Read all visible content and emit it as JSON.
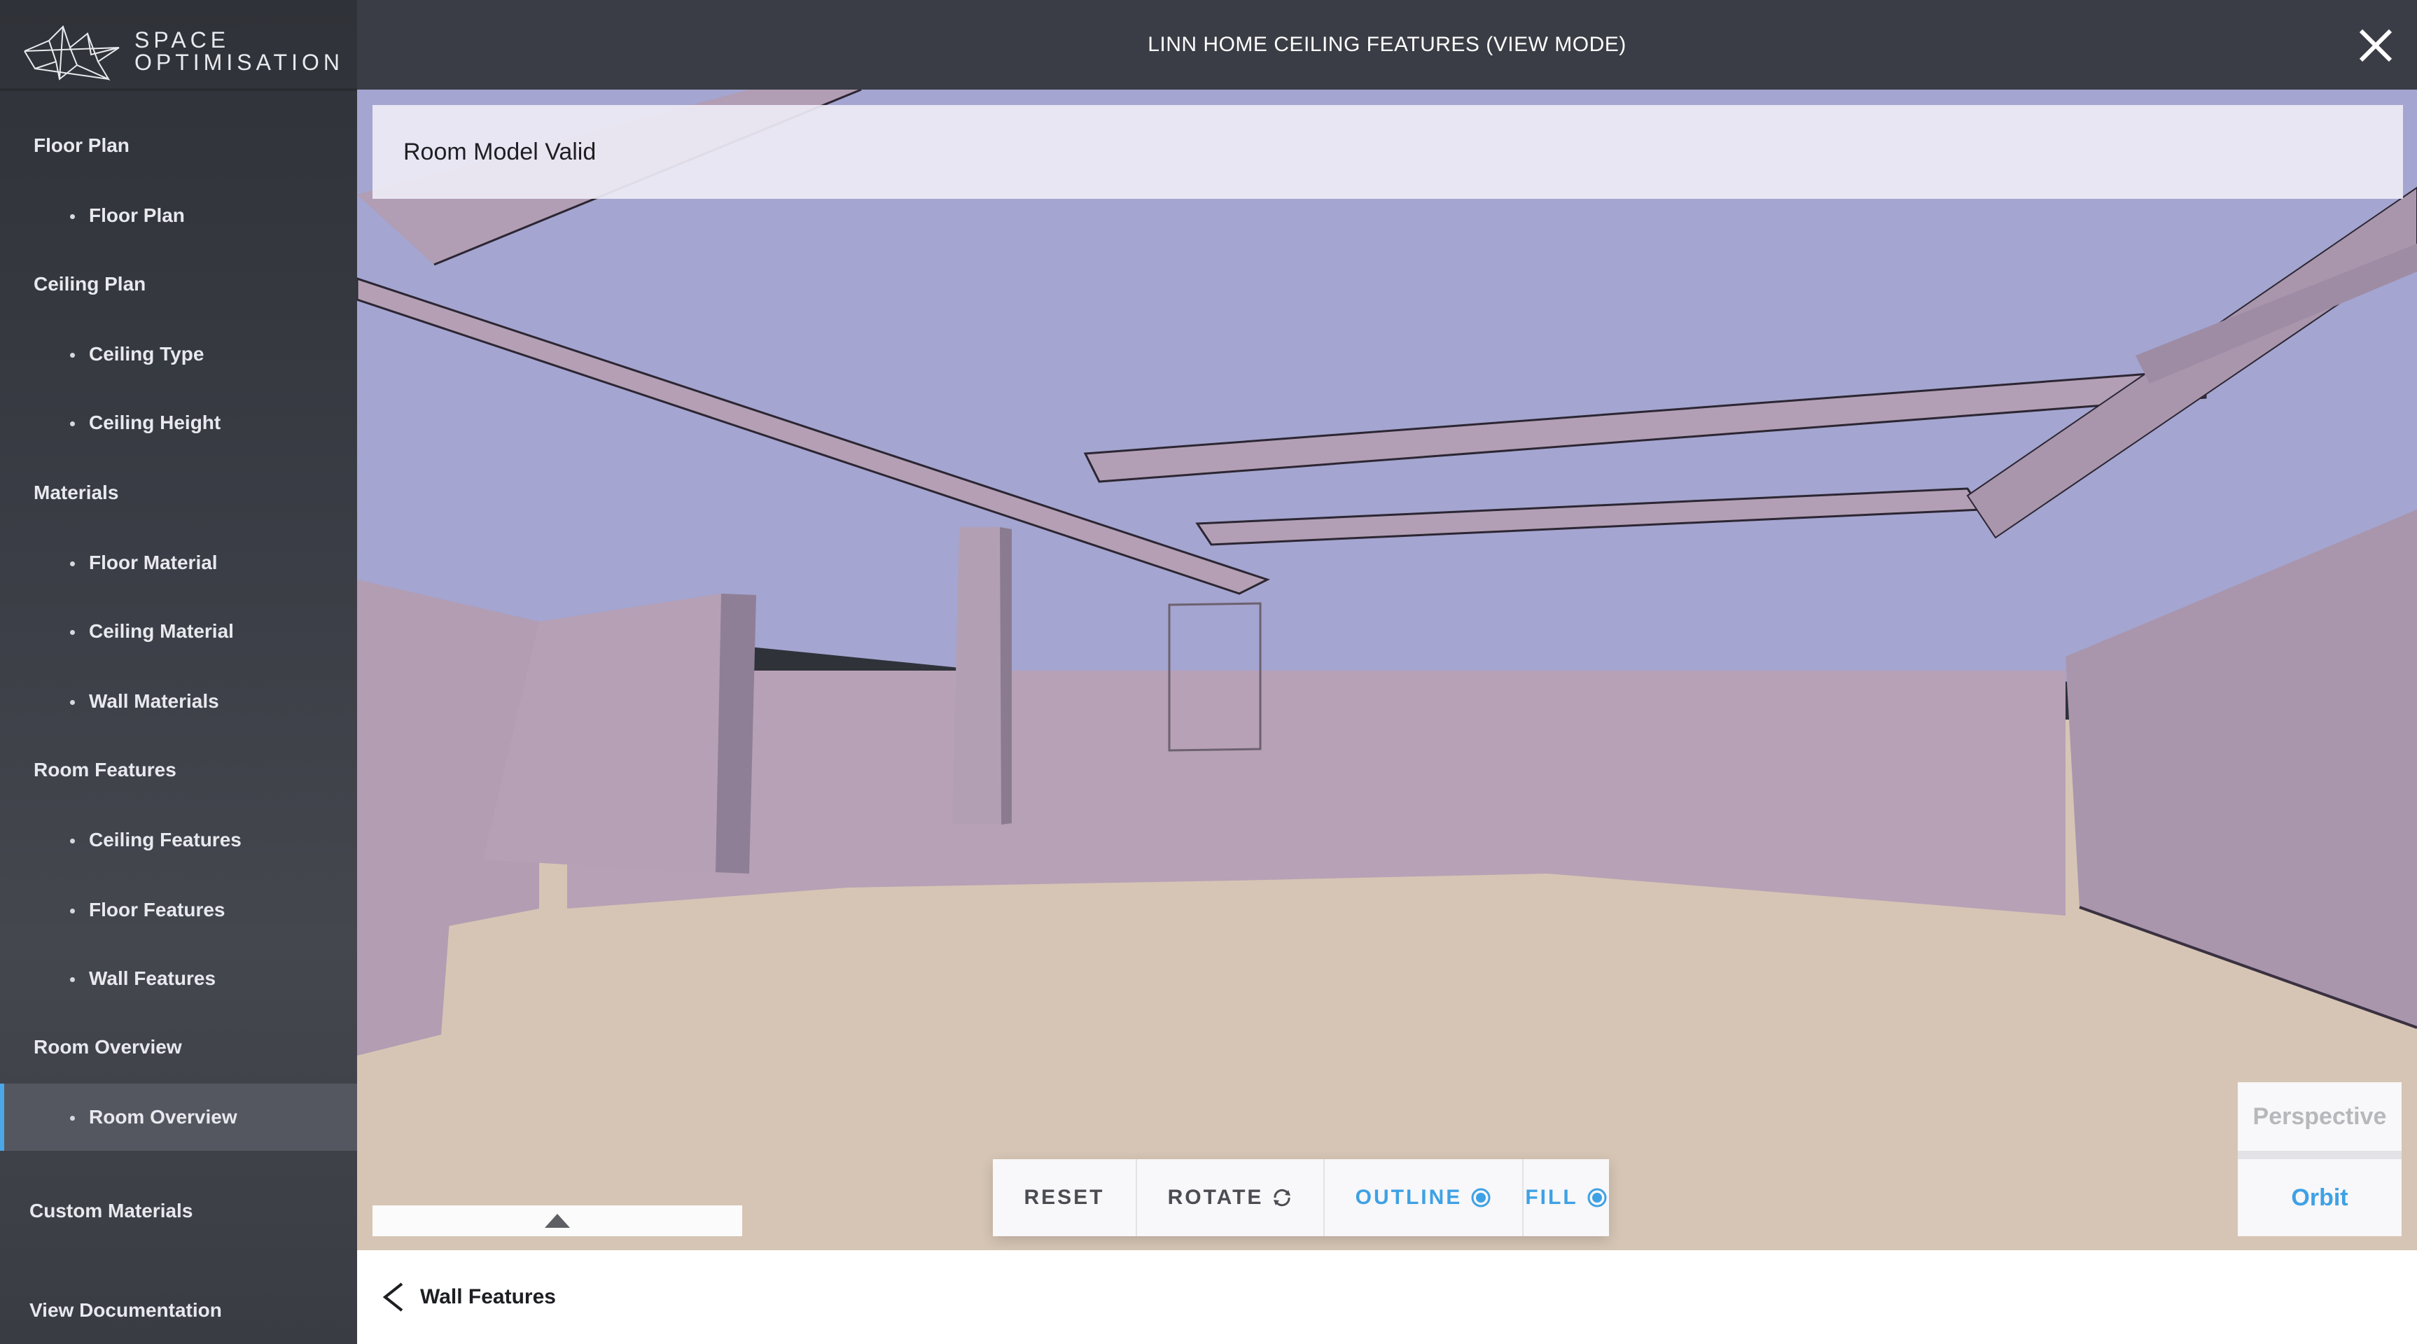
{
  "brand": {
    "line1": "SPACE",
    "line2": "OPTIMISATION"
  },
  "header": {
    "title": "LINN HOME CEILING FEATURES (VIEW MODE)",
    "close_icon": "close-icon"
  },
  "sidebar": {
    "sections": [
      {
        "label": "Floor Plan",
        "items": [
          {
            "label": "Floor Plan"
          }
        ]
      },
      {
        "label": "Ceiling Plan",
        "items": [
          {
            "label": "Ceiling Type"
          },
          {
            "label": "Ceiling Height"
          }
        ]
      },
      {
        "label": "Materials",
        "items": [
          {
            "label": "Floor Material"
          },
          {
            "label": "Ceiling Material"
          },
          {
            "label": "Wall Materials"
          }
        ]
      },
      {
        "label": "Room Features",
        "items": [
          {
            "label": "Ceiling Features"
          },
          {
            "label": "Floor Features"
          },
          {
            "label": "Wall Features"
          }
        ]
      },
      {
        "label": "Room Overview",
        "items": [
          {
            "label": "Room Overview",
            "active": true
          }
        ]
      }
    ],
    "footer_links": [
      {
        "label": "Custom Materials"
      },
      {
        "label": "View Documentation"
      }
    ]
  },
  "viewport": {
    "status": "Room Model Valid",
    "toolbar": {
      "reset": "RESET",
      "rotate": "ROTATE",
      "outline": "OUTLINE",
      "fill": "FILL"
    },
    "camera": {
      "perspective": "Perspective",
      "orbit": "Orbit",
      "selected": "Orbit"
    }
  },
  "footer": {
    "back_label": "Wall Features"
  },
  "colors": {
    "accent": "#3ea1e5",
    "sidebar_bg": "#3a3d45",
    "ceiling": "#a4a5d0",
    "wall": "#b59fb4",
    "floor": "#d6c5b4"
  }
}
